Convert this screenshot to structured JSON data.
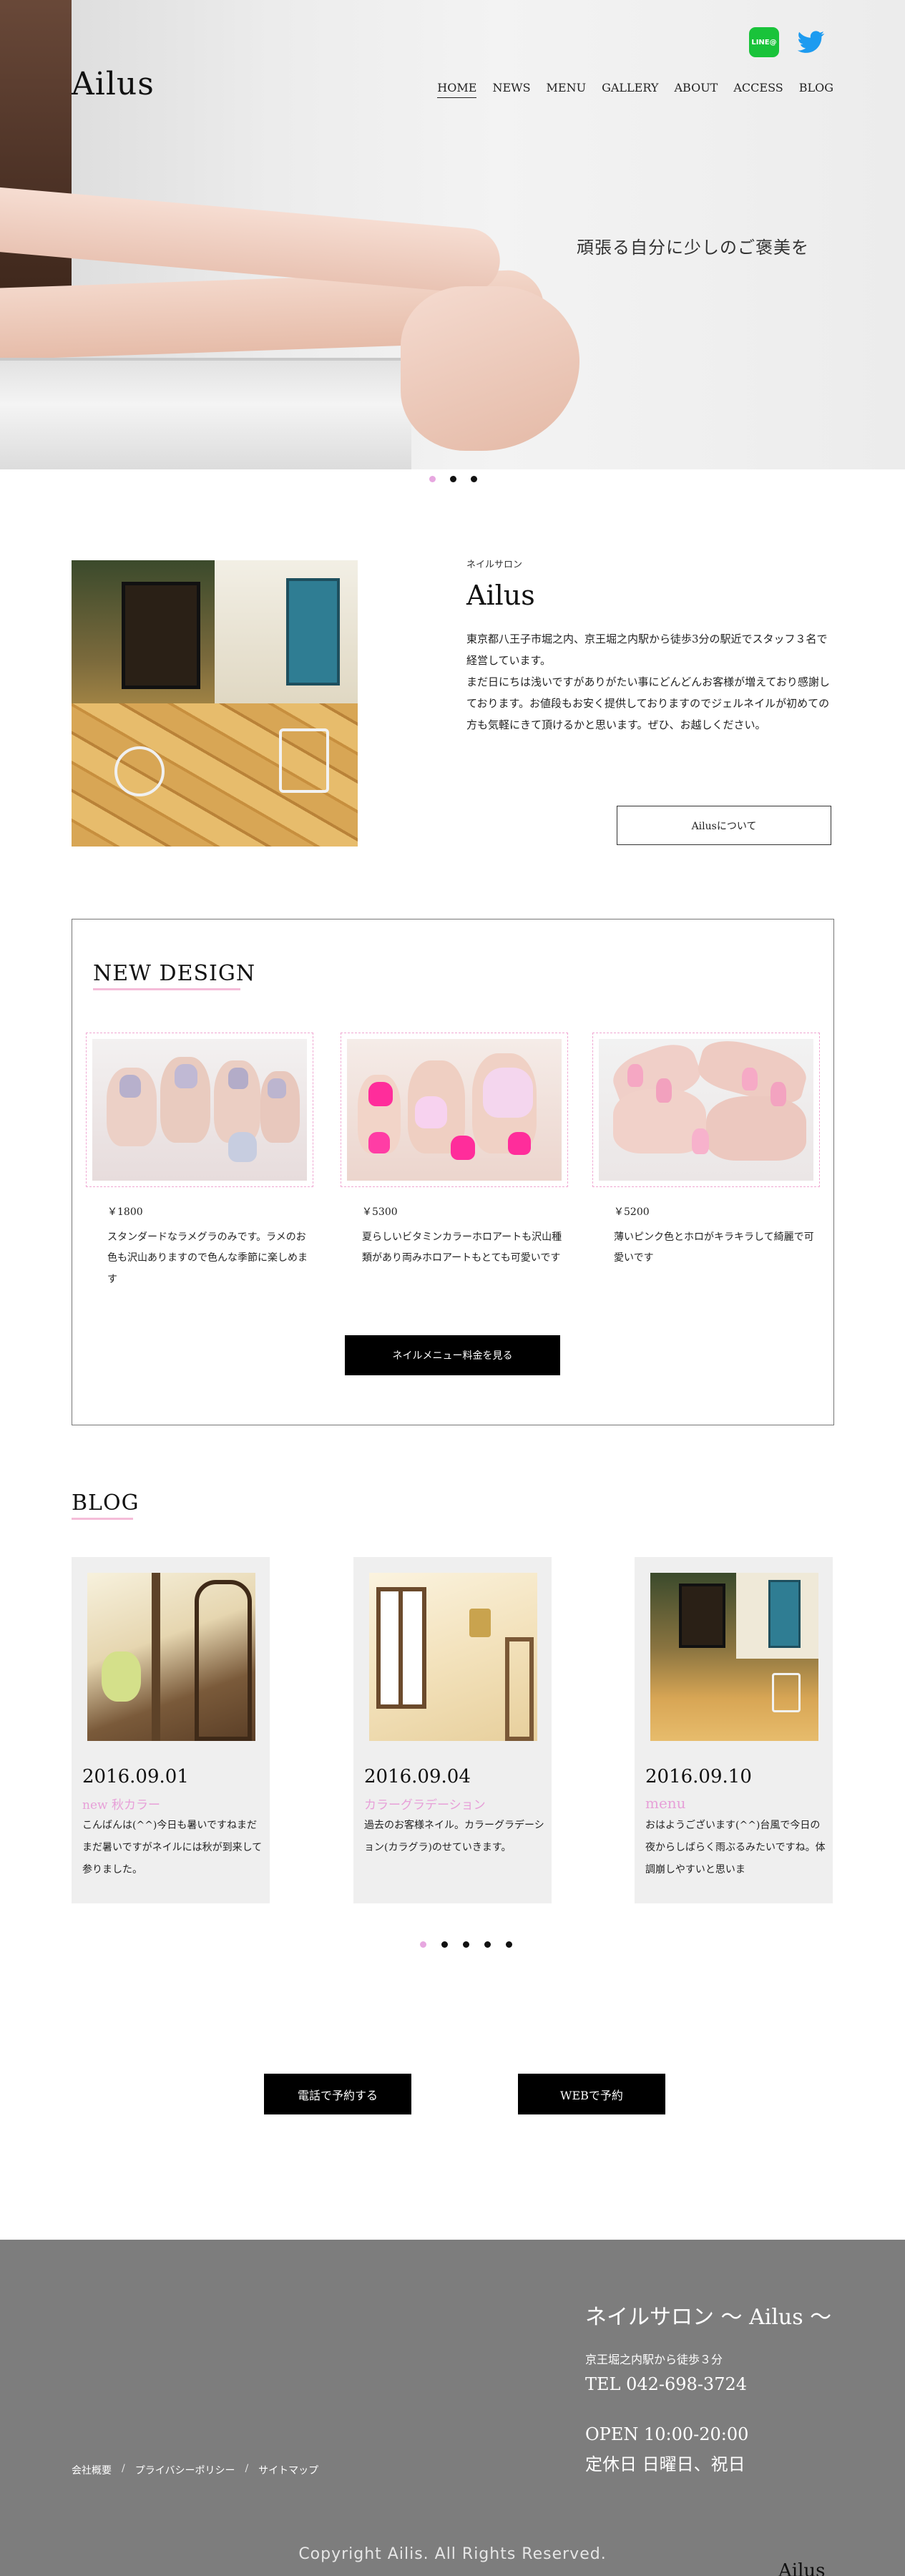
{
  "header": {
    "brand": "Ailus",
    "nav": [
      "HOME",
      "NEWS",
      "MENU",
      "GALLERY",
      "ABOUT",
      "ACCESS",
      "BLOG"
    ],
    "line_label": "LINE@",
    "twitter_icon": "twitter-bird-icon",
    "line_icon": "line-icon"
  },
  "hero": {
    "catch": "頑張る自分に少しのご褒美を",
    "slider_dots": 3,
    "active_dot": 1
  },
  "about": {
    "subtitle": "ネイルサロン",
    "title": "Ailus",
    "paragraphs": [
      "東京都八王子市堀之内、京王堀之内駅から徒歩3分の駅近でスタッフ３名で経営しています。",
      "まだ日にちは浅いですがありがたい事にどんどんお客様が増えており感謝しております。お値段もお安く提供しておりますのでジェルネイルが初めての方も気軽にきて頂けるかと思います。ぜひ、お越しください。"
    ],
    "button": "Ailusについて"
  },
  "new_design": {
    "title": "NEW DESIGN",
    "items": [
      {
        "price": "￥1800",
        "desc": "スタンダードなラメグラのみです。ラメのお色も沢山ありますので色んな季節に楽しめます"
      },
      {
        "price": "￥5300",
        "desc": "夏らしいビタミンカラーホロアートも沢山種類があり両みホロアートもとても可愛いです"
      },
      {
        "price": "￥5200",
        "desc": "薄いピンク色とホロがキラキラして綺麗で可愛いです"
      }
    ],
    "button": "ネイルメニュー料金を見る"
  },
  "blog": {
    "title": "BLOG",
    "posts": [
      {
        "date": "2016.09.01",
        "tag": "new 秋カラー",
        "text": "こんばんは(^^)今日も暑いですねまだまだ暑いですがネイルには秋が到来して参りました。"
      },
      {
        "date": "2016.09.04",
        "tag": "カラーグラデーション",
        "text": "過去のお客様ネイル。カラーグラデーション(カラグラ)のせていきます。"
      },
      {
        "date": "2016.09.10",
        "tag": "menu",
        "text": "おはようございます(^^)台風で今日の夜からしばらく雨ぶるみたいですね。体調崩しやすいと思いま"
      }
    ],
    "slider_dots": 5,
    "active_dot": 0
  },
  "cta": {
    "phone": "電話で予約する",
    "web": "WEBで予約"
  },
  "footer": {
    "title": "ネイルサロン 〜 Ailus 〜",
    "access": "京王堀之内駅から徒歩３分",
    "tel": "TEL 042-698-3724",
    "open": "OPEN 10:00-20:00",
    "holiday": "定休日 日曜日、祝日",
    "links": [
      "会社概要",
      "プライバシーポリシー",
      "サイトマップ"
    ],
    "copyright": "Copyright Ailis. All Rights Reserved.",
    "logo_peek": "Ailus"
  },
  "colors": {
    "accent_pink": "#e7a0d8",
    "line_green": "#19c33a",
    "twitter_blue": "#1d9bf0",
    "footer_gray": "#7d7d7d"
  }
}
